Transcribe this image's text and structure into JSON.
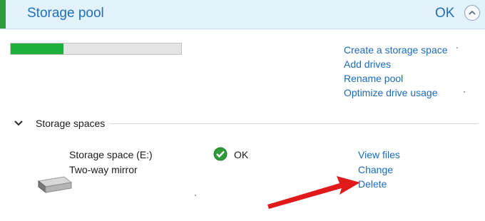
{
  "header": {
    "title": "Storage pool",
    "status": "OK",
    "accent_color": "#2e9a3a",
    "collapse_icon": "chevron-up-icon"
  },
  "pool": {
    "usage_fraction": 0.31,
    "usage_color": "#1db13c",
    "actions": [
      "Create a storage space",
      "Add drives",
      "Rename pool",
      "Optimize drive usage"
    ]
  },
  "storage_spaces": {
    "section_title": "Storage spaces",
    "toggle_icon": "chevron-down-icon",
    "space": {
      "name": "Storage space (E:)",
      "resiliency": "Two-way mirror",
      "status": "OK",
      "status_icon": "check-circle-icon",
      "drive_icon": "drive-icon",
      "actions": [
        "View files",
        "Change",
        "Delete"
      ]
    }
  },
  "annotation": {
    "arrow_color": "#e01a1a",
    "points_to": "Delete"
  }
}
